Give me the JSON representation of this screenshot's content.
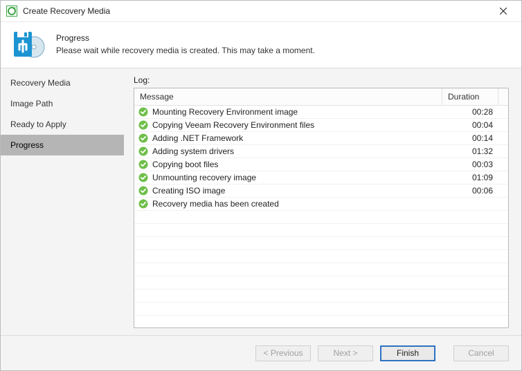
{
  "window": {
    "title": "Create Recovery Media"
  },
  "header": {
    "title": "Progress",
    "subtitle": "Please wait while recovery media is created. This may take a moment."
  },
  "sidebar": {
    "steps": [
      {
        "label": "Recovery Media",
        "current": false
      },
      {
        "label": "Image Path",
        "current": false
      },
      {
        "label": "Ready to Apply",
        "current": false
      },
      {
        "label": "Progress",
        "current": true
      }
    ]
  },
  "log": {
    "label": "Log:",
    "columns": {
      "message": "Message",
      "duration": "Duration"
    },
    "rows": [
      {
        "message": "Mounting Recovery Environment image",
        "duration": "00:28",
        "status": "success"
      },
      {
        "message": "Copying Veeam Recovery Environment files",
        "duration": "00:04",
        "status": "success"
      },
      {
        "message": "Adding .NET Framework",
        "duration": "00:14",
        "status": "success"
      },
      {
        "message": "Adding system drivers",
        "duration": "01:32",
        "status": "success"
      },
      {
        "message": "Copying boot files",
        "duration": "00:03",
        "status": "success"
      },
      {
        "message": "Unmounting recovery image",
        "duration": "01:09",
        "status": "success"
      },
      {
        "message": "Creating ISO image",
        "duration": "00:06",
        "status": "success"
      },
      {
        "message": "Recovery media has been created",
        "duration": "",
        "status": "success"
      }
    ],
    "blank_rows": 10
  },
  "footer": {
    "previous": "< Previous",
    "next": "Next >",
    "finish": "Finish",
    "cancel": "Cancel"
  }
}
